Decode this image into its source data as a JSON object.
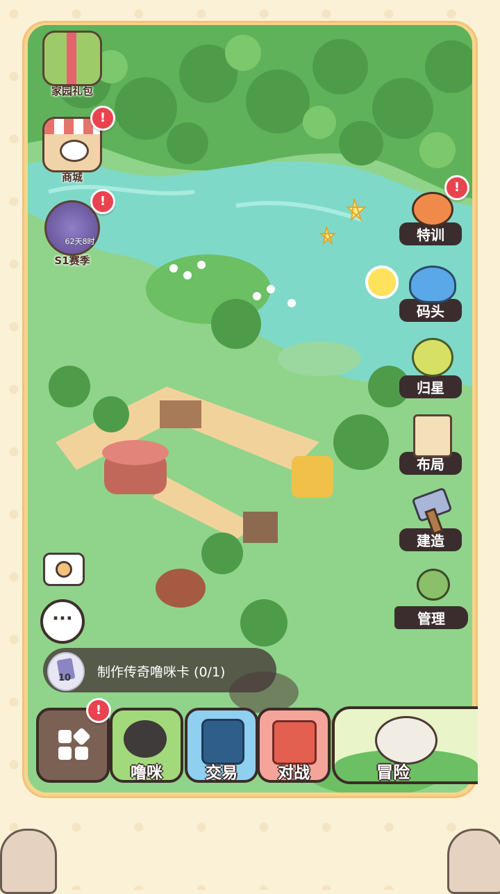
{
  "left_menu": [
    {
      "label": "家园礼包",
      "icon": "gift-basket-icon",
      "alert": false
    },
    {
      "label": "商城",
      "icon": "shop-icon",
      "alert": true,
      "alert_text": "!"
    },
    {
      "label": "S1赛季",
      "icon": "season-knight-icon",
      "alert": true,
      "alert_text": "!",
      "timer": "62天8时"
    }
  ],
  "right_menu": [
    {
      "label": "特训",
      "icon": "training-icon",
      "alert": true,
      "alert_text": "!"
    },
    {
      "label": "码头",
      "icon": "whale-dock-icon",
      "alert": false
    },
    {
      "label": "归星",
      "icon": "star-tree-icon",
      "alert": false
    },
    {
      "label": "布局",
      "icon": "layout-scroll-icon",
      "alert": false
    },
    {
      "label": "建造",
      "icon": "hammer-icon",
      "alert": false
    },
    {
      "label": "管理",
      "icon": "robot-manager-icon",
      "alert": false
    }
  ],
  "quest": {
    "text": "制作传奇噜咪卡 (0/1)",
    "count": "10"
  },
  "chat_glyph": "···",
  "bottom_bar": [
    {
      "label": "",
      "icon": "menu-grid-icon",
      "alert": true,
      "alert_text": "!"
    },
    {
      "label": "噜咪",
      "icon": "cat-icon"
    },
    {
      "label": "交易",
      "icon": "trade-machine-icon"
    },
    {
      "label": "对战",
      "icon": "battle-cards-icon"
    },
    {
      "label": "冒险",
      "icon": "adventure-cat-icon"
    }
  ],
  "colors": {
    "frame": "#f7d48d",
    "label_bg": "#3b2d2e",
    "alert": "#e9434f",
    "grass": "#8fd48a",
    "water": "#7fd9c9"
  }
}
